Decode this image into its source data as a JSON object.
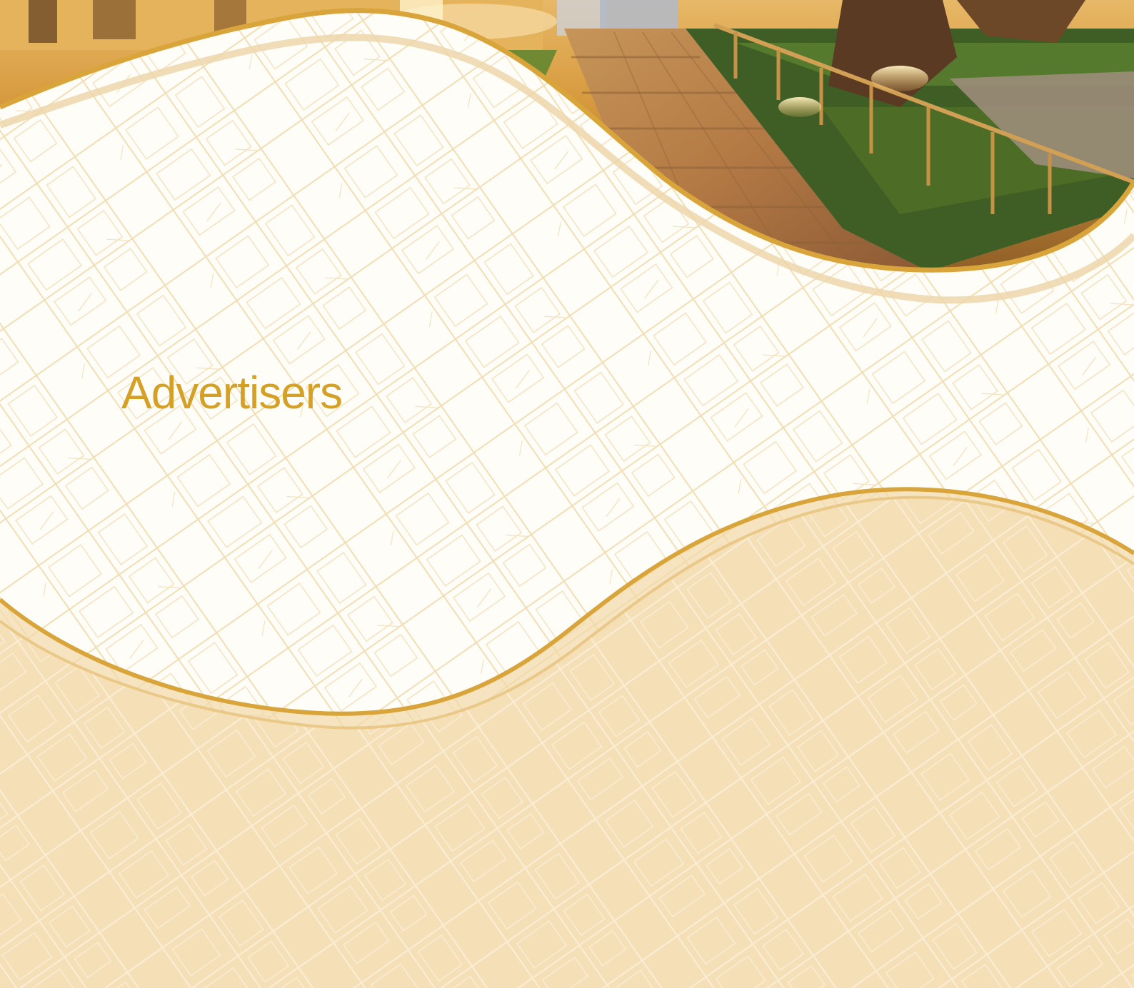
{
  "page": {
    "title": "Advertisers"
  },
  "colors": {
    "accent_gold": "#d9a43a",
    "light_gold": "#f3ddb3",
    "map_line": "#f4dfb7",
    "title_color": "#d4a126",
    "background": "#fffdf8"
  },
  "images": {
    "photo": "night-walkway-plaza-photo",
    "pattern": "street-map-pattern"
  }
}
